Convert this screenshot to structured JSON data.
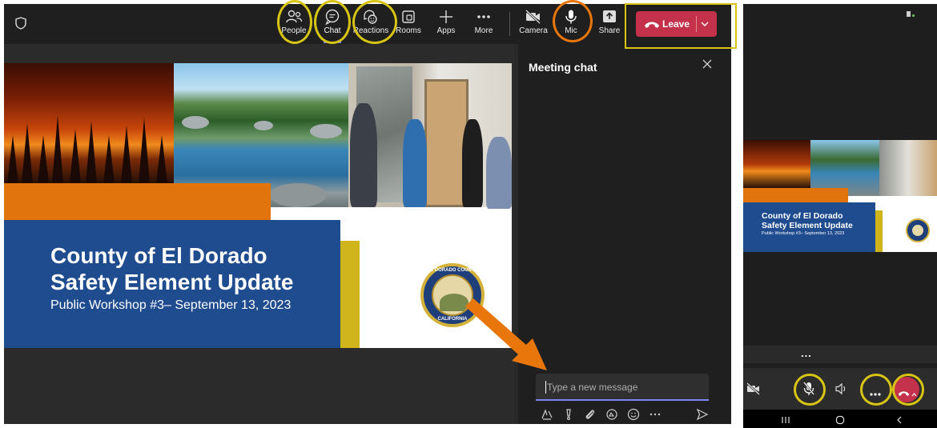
{
  "desktop": {
    "toolbar": {
      "people": "People",
      "chat": "Chat",
      "reactions": "Reactions",
      "rooms": "Rooms",
      "apps": "Apps",
      "more": "More",
      "camera": "Camera",
      "mic": "Mic",
      "share": "Share",
      "leave": "Leave"
    },
    "slide": {
      "title_line1": "County of El Dorado",
      "title_line2": "Safety Element Update",
      "subtitle": "Public Workshop #3– September 13, 2023",
      "seal_top": "EL DORADO COUNTY",
      "seal_bottom": "CALIFORNIA"
    },
    "chat": {
      "title": "Meeting chat",
      "placeholder": "Type a new message"
    }
  },
  "phone": {
    "slide": {
      "title_line1": "County of El Dorado",
      "title_line2": "Safety Element Update",
      "subtitle": "Public Workshop #3– September 13, 2023"
    },
    "more_label": "..."
  },
  "colors": {
    "accent": "#7f85f5",
    "leave_red": "#c4314b",
    "annotation_yellow": "#d8c414",
    "annotation_orange": "#e8760b",
    "slide_blue": "#1f4b8f",
    "slide_orange": "#e2740d"
  }
}
